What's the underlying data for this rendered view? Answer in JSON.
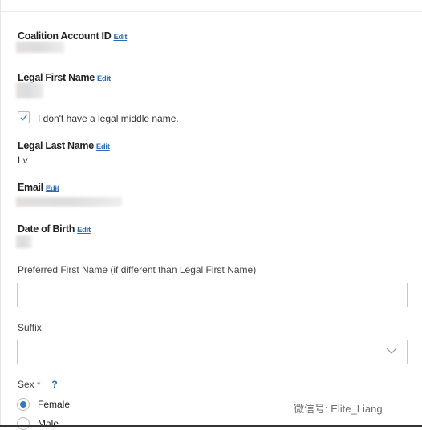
{
  "fields": {
    "coalition_id": {
      "label": "Coalition Account ID",
      "edit": "Edit"
    },
    "first_name": {
      "label": "Legal First Name",
      "edit": "Edit"
    },
    "no_middle": {
      "label": "I don't have a legal middle name.",
      "checked": true
    },
    "last_name": {
      "label": "Legal Last Name",
      "edit": "Edit",
      "value": "Lv"
    },
    "email": {
      "label": "Email",
      "edit": "Edit"
    },
    "dob": {
      "label": "Date of Birth",
      "edit": "Edit"
    },
    "preferred": {
      "label": "Preferred First Name (if different than Legal First Name)",
      "value": ""
    },
    "suffix": {
      "label": "Suffix",
      "value": ""
    },
    "sex": {
      "label": "Sex",
      "required": "*",
      "help": "?",
      "options": [
        {
          "label": "Female",
          "selected": true
        },
        {
          "label": "Male",
          "selected": false
        }
      ]
    }
  },
  "watermark": "微信号: Elite_Liang",
  "colors": {
    "accent": "#2b6cb0",
    "required": "#c0392b"
  }
}
